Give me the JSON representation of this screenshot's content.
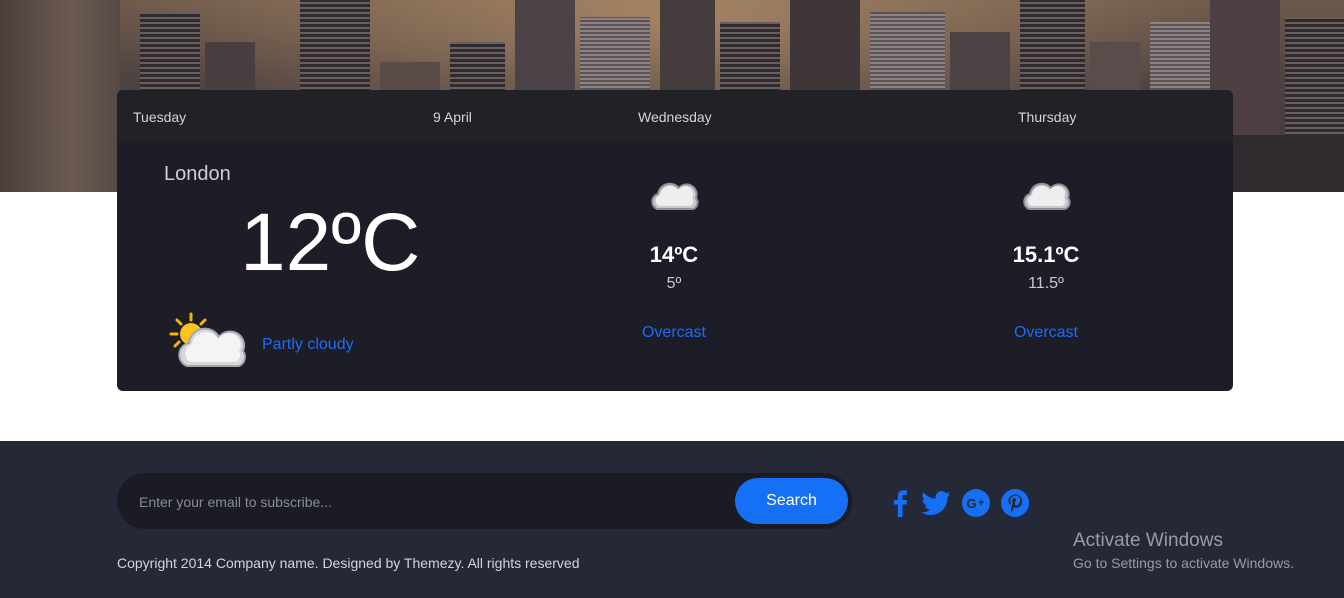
{
  "weather": {
    "today": {
      "day": "Tuesday",
      "date": "9 April",
      "city": "London",
      "temp": "12ºC",
      "condition": "Partly cloudy",
      "icon": "partly-cloudy-icon"
    },
    "forecast": [
      {
        "day": "Wednesday",
        "temp": "14ºC",
        "low": "5º",
        "condition": "Overcast",
        "icon": "cloud-icon"
      },
      {
        "day": "Thursday",
        "temp": "15.1ºC",
        "low": "11.5º",
        "condition": "Overcast",
        "icon": "cloud-icon"
      }
    ]
  },
  "footer": {
    "subscribe_placeholder": "Enter your email to subscribe...",
    "search_label": "Search",
    "social": [
      "facebook-icon",
      "twitter-icon",
      "google-plus-icon",
      "pinterest-icon"
    ],
    "copyright": "Copyright 2014 Company name. Designed by Themezy. All rights reserved"
  },
  "watermark": {
    "title": "Activate Windows",
    "subtitle": "Go to Settings to activate Windows."
  },
  "colors": {
    "accent": "#1570f6",
    "card_bg": "#1c1d27",
    "footer_bg": "#252836"
  }
}
